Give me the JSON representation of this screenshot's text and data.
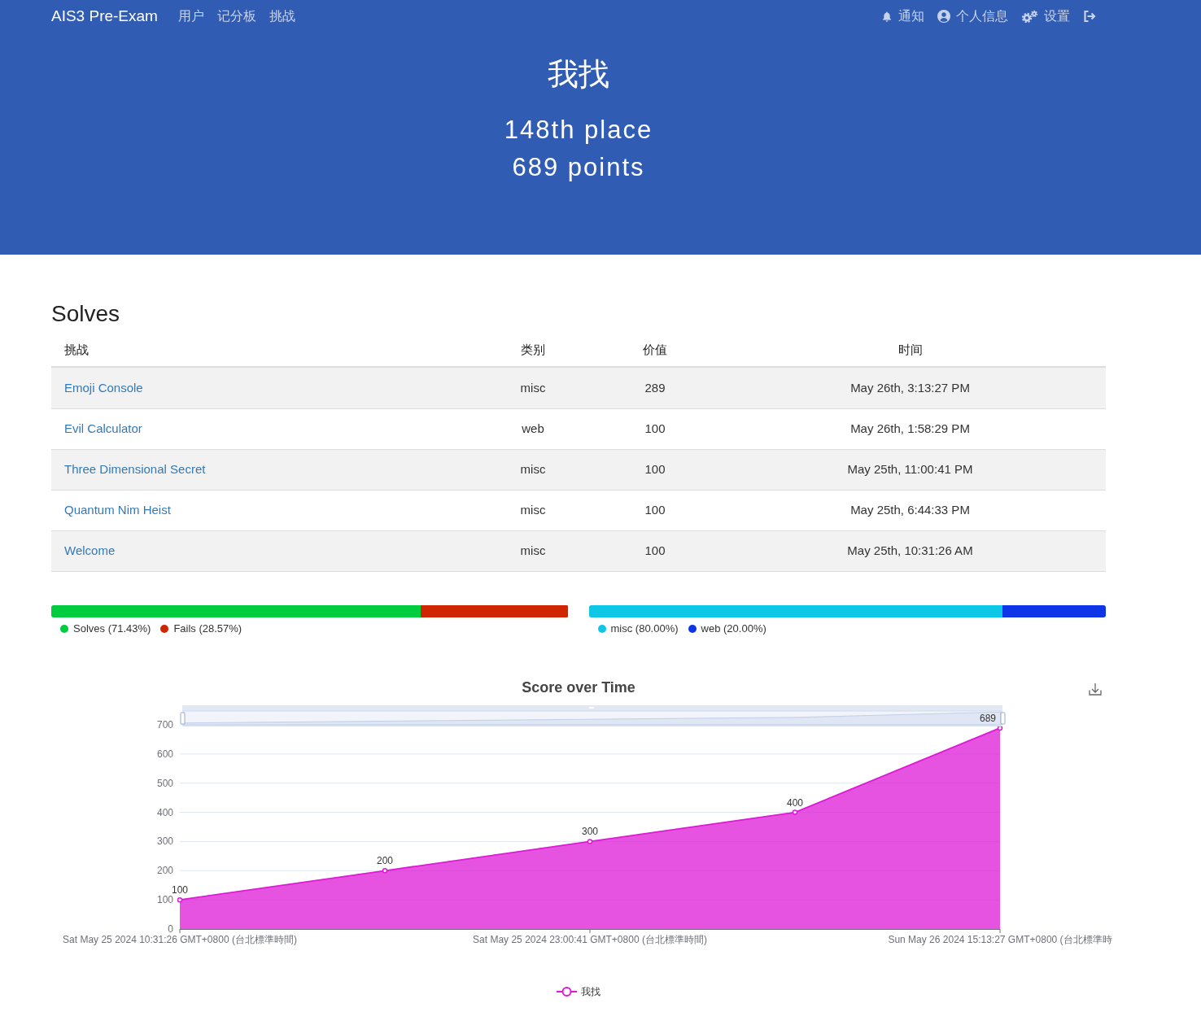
{
  "navbar": {
    "brand": "AIS3 Pre-Exam",
    "links": [
      {
        "label": "用户"
      },
      {
        "label": "记分板"
      },
      {
        "label": "挑战"
      }
    ],
    "right_links": [
      {
        "kind": "notifications",
        "label": "通知"
      },
      {
        "kind": "profile",
        "label": "个人信息"
      },
      {
        "kind": "settings",
        "label": "设置"
      },
      {
        "kind": "logout"
      }
    ]
  },
  "hero": {
    "team_name": "我找",
    "place": "148th place",
    "points": "689 points"
  },
  "solves": {
    "title": "Solves",
    "columns": [
      "挑战",
      "类别",
      "价值",
      "时间"
    ],
    "rows": [
      {
        "cells": [
          "Emoji Console",
          "misc",
          "289",
          "May 26th, 3:13:27 PM"
        ]
      },
      {
        "cells": [
          "Evil Calculator",
          "web",
          "100",
          "May 26th, 1:58:29 PM"
        ]
      },
      {
        "cells": [
          "Three Dimensional Secret",
          "misc",
          "100",
          "May 25th, 11:00:41 PM"
        ]
      },
      {
        "cells": [
          "Quantum Nim Heist",
          "misc",
          "100",
          "May 25th, 6:44:33 PM"
        ]
      },
      {
        "cells": [
          "Welcome",
          "misc",
          "100",
          "May 25th, 10:31:26 AM"
        ]
      }
    ]
  },
  "breakdowns": [
    {
      "segments": [
        {
          "label": "Solves (71.43%)",
          "level": 0.7143,
          "color": "#00cc3f"
        },
        {
          "label": "Fails (28.57%)",
          "level": 0.2857,
          "color": "#cf2600"
        }
      ]
    },
    {
      "segments": [
        {
          "label": "misc (80.00%)",
          "level": 0.8,
          "color": "#0ec6e6"
        },
        {
          "label": "web (20.00%)",
          "level": 0.2,
          "color": "#0f36e6"
        }
      ]
    }
  ],
  "score_chart": {
    "chart_data": {
      "type": "area",
      "title": "Score over Time",
      "categories": [
        "Sat May 25 2024 10:31:26 GMT+0800 (台北標準時間)",
        null,
        "Sat May 25 2024 23:00:41 GMT+0800 (台北標準時間)",
        null,
        "Sun May 26 2024 15:13:27 GMT+0800 (台北標準時"
      ],
      "ylim": [
        0,
        700
      ],
      "yticks": [
        0,
        100,
        200,
        300,
        400,
        500,
        600,
        700
      ],
      "grid": true,
      "series": [
        {
          "name": "我找",
          "color": "#dd1ad6",
          "values": [
            100,
            200,
            300,
            400,
            689
          ]
        }
      ],
      "data_labels": true
    }
  }
}
